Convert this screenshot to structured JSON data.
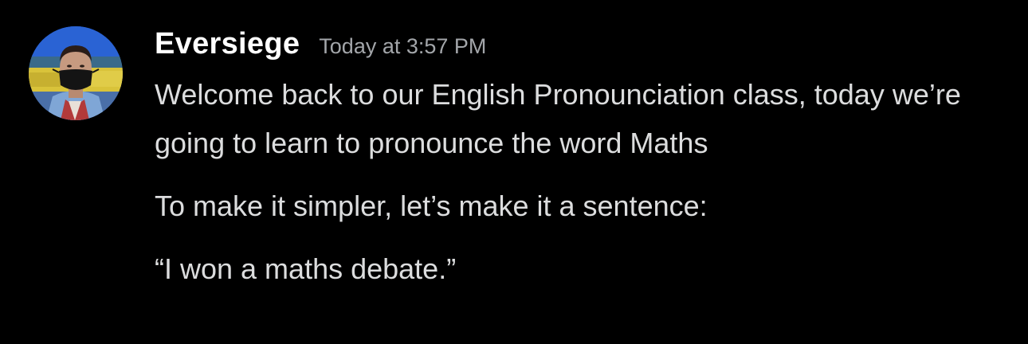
{
  "message": {
    "username": "Eversiege",
    "timestamp": "Today at 3:57 PM",
    "paragraphs": [
      "Welcome back to our English Pronounciation class, today we’re going to learn to pronounce the word Maths",
      "To make it simpler, let’s make it a sentence:",
      "“I won a maths debate.”"
    ]
  },
  "colors": {
    "background": "#000000",
    "username": "#ffffff",
    "timestamp": "#a3a6aa",
    "text": "#dcddde"
  },
  "avatar": {
    "icon": "user-avatar-photo"
  }
}
